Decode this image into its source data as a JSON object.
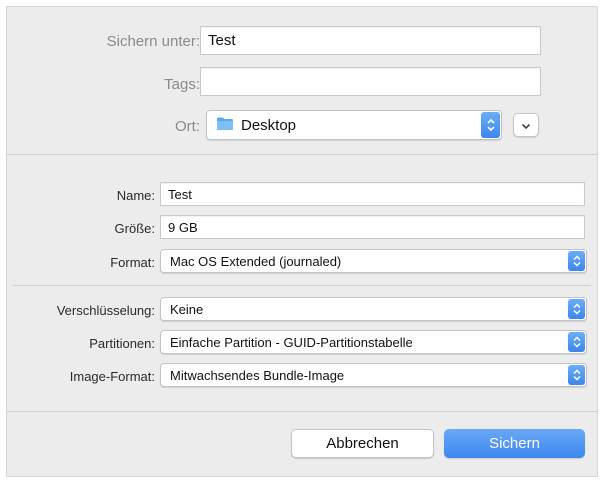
{
  "top": {
    "save_as_label": "Sichern unter:",
    "save_as_value": "Test",
    "tags_label": "Tags:",
    "tags_value": "",
    "location_label": "Ort:",
    "location_value": "Desktop"
  },
  "image": {
    "name_label": "Name:",
    "name_value": "Test",
    "size_label": "Größe:",
    "size_value": "9 GB",
    "format_label": "Format:",
    "format_value": "Mac OS Extended (journaled)",
    "encryption_label": "Verschlüsselung:",
    "encryption_value": "Keine",
    "partitions_label": "Partitionen:",
    "partitions_value": "Einfache Partition - GUID-Partitionstabelle",
    "image_format_label": "Image-Format:",
    "image_format_value": "Mitwachsendes Bundle-Image"
  },
  "buttons": {
    "cancel_label": "Abbrechen",
    "save_label": "Sichern"
  },
  "colors": {
    "accent": "#3c86ec",
    "primary_button": "#4f93f2",
    "folder": "#5aa9ee"
  }
}
